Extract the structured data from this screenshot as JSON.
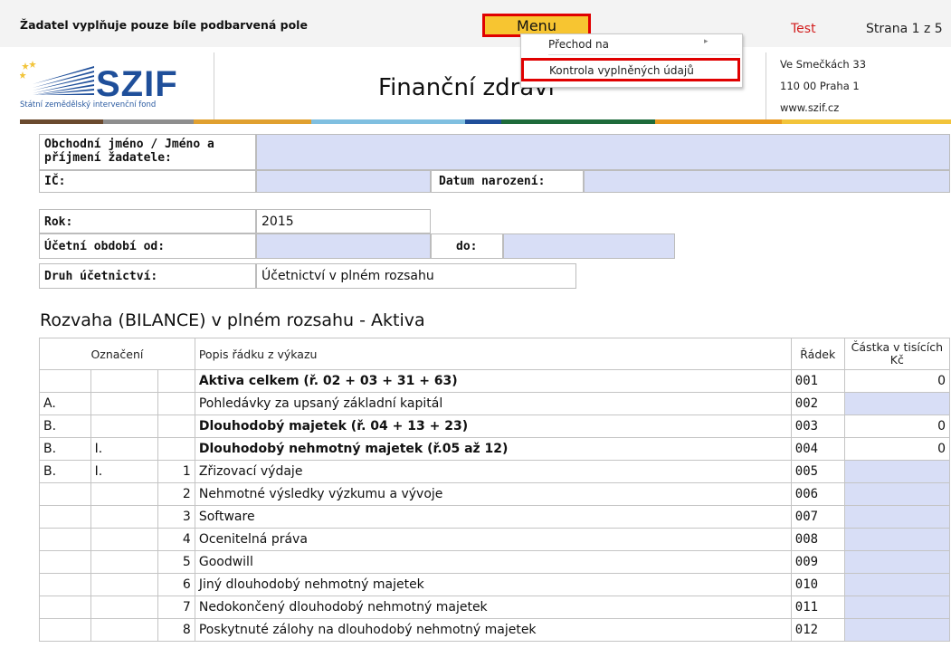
{
  "topbar": {
    "instruction": "Žadatel vyplňuje pouze bíle podbarvená pole",
    "menu_label": "Menu",
    "test_label": "Test",
    "page_label": "Strana 1 z 5"
  },
  "dropdown": {
    "items": [
      "Přechod na",
      "Kontrola vyplněných údajů"
    ]
  },
  "header": {
    "logo": "SZIF",
    "logo_sub": "Státní zemědělský intervenční fond",
    "title": "Finanční zdraví",
    "address": [
      "Ve Smečkách 33",
      "110 00 Praha 1",
      "www.szif.cz"
    ]
  },
  "stripe_colors": [
    "#6b4a2e",
    "#8e8e8e",
    "#e0a030",
    "#7fbfe0",
    "#1f4f9a",
    "#1e6b3a",
    "#e89a20",
    "#f2c43a"
  ],
  "applicant": {
    "name_label": "Obchodní jméno / Jméno a příjmení žadatele:",
    "ic_label": "IČ:",
    "birth_label": "Datum narození:"
  },
  "period": {
    "year_label": "Rok:",
    "year_value": "2015",
    "from_label": "Účetní období od:",
    "to_label": "do:",
    "type_label": "Druh účetnictví:",
    "type_value": "Účetnictví v plném rozsahu"
  },
  "section_title": "Rozvaha (BILANCE) v plném rozsahu - Aktiva",
  "table": {
    "headers": [
      "Označení",
      "Popis řádku z výkazu",
      "Řádek",
      "Částka v tisících Kč"
    ],
    "rows": [
      {
        "a": "",
        "b": "",
        "c": "",
        "desc": "Aktiva celkem (ř. 02 + 03 + 31 + 63)",
        "row": "001",
        "amount": "0",
        "bold": true,
        "input": false
      },
      {
        "a": "A.",
        "b": "",
        "c": "",
        "desc": "Pohledávky za upsaný základní kapitál",
        "row": "002",
        "amount": "",
        "bold": false,
        "input": true
      },
      {
        "a": "B.",
        "b": "",
        "c": "",
        "desc": "Dlouhodobý majetek (ř. 04 + 13 + 23)",
        "row": "003",
        "amount": "0",
        "bold": true,
        "input": false
      },
      {
        "a": "B.",
        "b": "I.",
        "c": "",
        "desc": "Dlouhodobý nehmotný majetek (ř.05 až 12)",
        "row": "004",
        "amount": "0",
        "bold": true,
        "input": false
      },
      {
        "a": "B.",
        "b": "I.",
        "c": "1",
        "desc": "Zřizovací výdaje",
        "row": "005",
        "amount": "",
        "bold": false,
        "input": true
      },
      {
        "a": "",
        "b": "",
        "c": "2",
        "desc": "Nehmotné výsledky výzkumu a vývoje",
        "row": "006",
        "amount": "",
        "bold": false,
        "input": true
      },
      {
        "a": "",
        "b": "",
        "c": "3",
        "desc": "Software",
        "row": "007",
        "amount": "",
        "bold": false,
        "input": true
      },
      {
        "a": "",
        "b": "",
        "c": "4",
        "desc": "Ocenitelná práva",
        "row": "008",
        "amount": "",
        "bold": false,
        "input": true
      },
      {
        "a": "",
        "b": "",
        "c": "5",
        "desc": "Goodwill",
        "row": "009",
        "amount": "",
        "bold": false,
        "input": true
      },
      {
        "a": "",
        "b": "",
        "c": "6",
        "desc": "Jiný dlouhodobý nehmotný majetek",
        "row": "010",
        "amount": "",
        "bold": false,
        "input": true
      },
      {
        "a": "",
        "b": "",
        "c": "7",
        "desc": "Nedokončený dlouhodobý nehmotný majetek",
        "row": "011",
        "amount": "",
        "bold": false,
        "input": true
      },
      {
        "a": "",
        "b": "",
        "c": "8",
        "desc": "Poskytnuté zálohy na dlouhodobý nehmotný majetek",
        "row": "012",
        "amount": "",
        "bold": false,
        "input": true
      }
    ]
  }
}
